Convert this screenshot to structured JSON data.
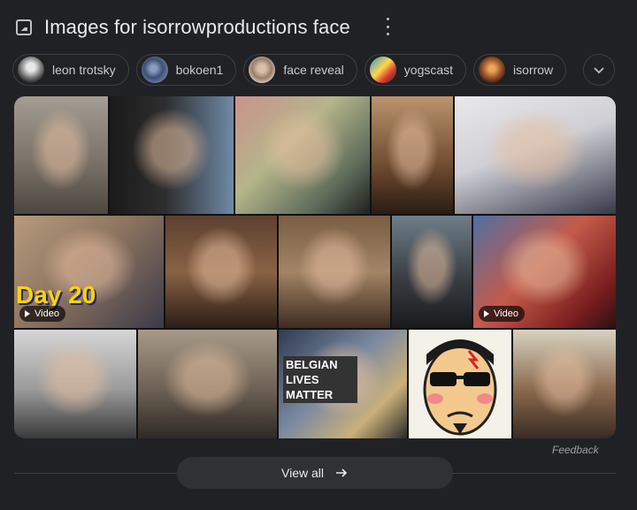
{
  "header": {
    "title": "Images for isorrowproductions face"
  },
  "chips": [
    {
      "label": "leon trotsky"
    },
    {
      "label": "bokoen1"
    },
    {
      "label": "face reveal"
    },
    {
      "label": "yogscast"
    },
    {
      "label": "isorrow"
    }
  ],
  "tiles": {
    "video_label": "Video",
    "day_text": "Day 20",
    "sign_text": "BELGIAN LIVES MATTER"
  },
  "footer": {
    "feedback": "Feedback",
    "view_all": "View all"
  }
}
